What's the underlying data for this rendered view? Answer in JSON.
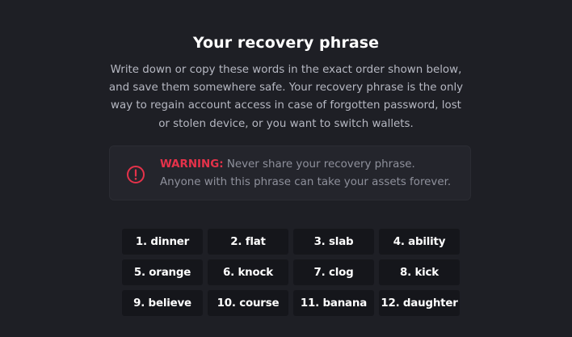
{
  "title": "Your recovery phrase",
  "description": "Write down or copy these words in the exact order shown below, and save them somewhere safe. Your recovery phrase is the only way to regain account access in case of forgotten password, lost or stolen device, or you want to switch wallets.",
  "warning": {
    "label": "WARNING:",
    "line1": " Never share your recovery phrase.",
    "line2": "Anyone with this phrase can take your assets forever.",
    "icon": "exclamation-circle-icon",
    "color": "#e5324a"
  },
  "words": [
    "1. dinner",
    "2. flat",
    "3. slab",
    "4. ability",
    "5. orange",
    "6. knock",
    "7. clog",
    "8. kick",
    "9. believe",
    "10. course",
    "11. banana",
    "12. daughter"
  ]
}
